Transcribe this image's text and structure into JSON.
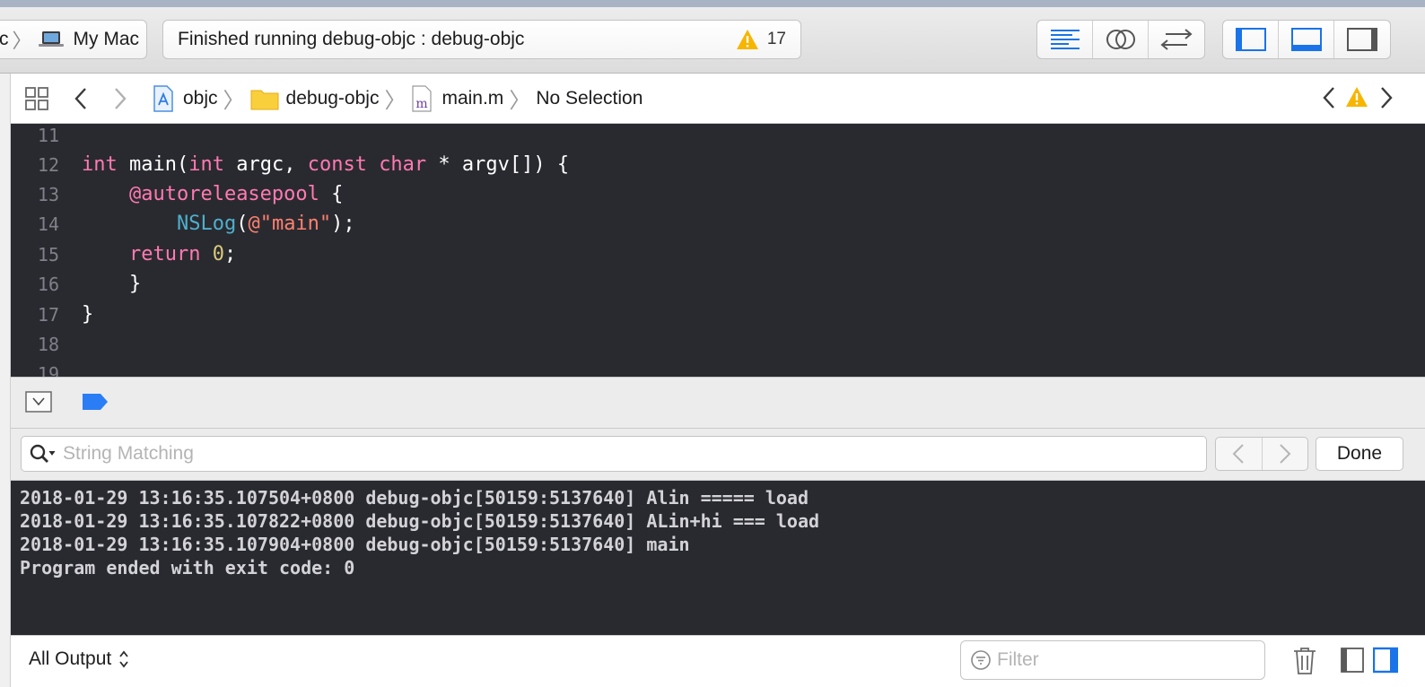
{
  "toolbar": {
    "scheme_crumb": "c",
    "destination": "My Mac",
    "status_text": "Finished running debug-objc : debug-objc",
    "warning_count": "17",
    "editor_modes": [
      "standard-editor-icon",
      "assistant-editor-icon",
      "version-editor-icon"
    ],
    "view_toggles": [
      "navigator-toggle-icon",
      "debug-area-toggle-icon",
      "utilities-toggle-icon"
    ],
    "accent_color": "#1a73e8"
  },
  "jumpbar": {
    "crumbs": [
      {
        "label": "objc",
        "icon": "project-icon"
      },
      {
        "label": "debug-objc",
        "icon": "folder-icon"
      },
      {
        "label": "main.m",
        "icon": "objc-file-icon"
      },
      {
        "label": "No Selection"
      }
    ]
  },
  "editor": {
    "line_numbers": [
      "11",
      "12",
      "13",
      "14",
      "15",
      "16",
      "17",
      "18",
      "19"
    ]
  },
  "find": {
    "placeholder": "String Matching",
    "done_label": "Done"
  },
  "console": {
    "lines": [
      "2018-01-29 13:16:35.107504+0800 debug-objc[50159:5137640] Alin ===== load",
      "2018-01-29 13:16:35.107822+0800 debug-objc[50159:5137640] ALin+hi === load",
      "2018-01-29 13:16:35.107904+0800 debug-objc[50159:5137640] main",
      "Program ended with exit code: 0"
    ]
  },
  "bottom": {
    "output_selector": "All Output",
    "filter_placeholder": "Filter"
  }
}
